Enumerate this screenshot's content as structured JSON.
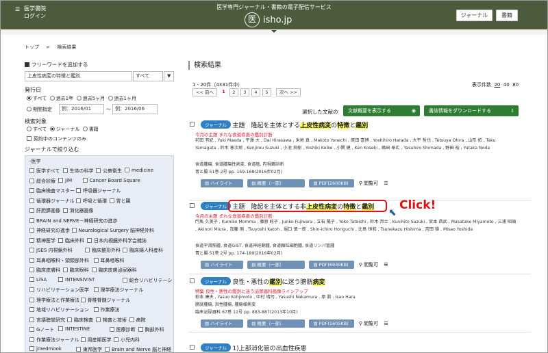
{
  "header": {
    "brand": "医学書院",
    "login": "ログイン",
    "service_title": "医学専門ジャーナル・書籍の電子配信サービス",
    "logo_text": "isho.jp",
    "journal_btn": "ジャーナル",
    "books_btn": "書籍"
  },
  "breadcrumb": {
    "top": "トップ",
    "sep": ">",
    "current": "検索結果"
  },
  "sidebar": {
    "free_word": "フリーワードを追加する",
    "search_value": "上皮性病変の特徴と鑑別",
    "search_scope": "すべて",
    "pub_date_label": "発行日",
    "pub_options": [
      "すべて",
      "過去1年",
      "過去5ヶ月",
      "過去1ヶ月"
    ],
    "period_label": "期間指定",
    "date_from": "例：2016/01",
    "date_tilde": "～",
    "date_to": "例：2016/06",
    "target_label": "検索対象",
    "target_options": [
      "すべて",
      "ジャーナル",
      "書籍"
    ],
    "contract_only": "契約中のコンテンツのみ",
    "narrow_label": "ジャーナルで絞り込む",
    "group": "-医学",
    "journals": [
      [
        "医学すべて",
        "生体の科学",
        "公衆衛生",
        "medicine"
      ],
      [
        "総合診療",
        "JIM",
        "Cancer Board Square"
      ],
      [
        "臨床検査マスター",
        "呼吸器ジャーナル"
      ],
      [
        "循環器ジャーナル",
        "呼吸と循環",
        "胃と腸"
      ],
      [
        "肝胆膵画像",
        "消化器画像"
      ],
      [
        "BRAIN and NERVE－神経研究の進歩"
      ],
      [
        "神経研究の進歩",
        "Neurological Surgery 脳神経外科"
      ],
      [
        "精神医学",
        "臨床外科",
        "日本内視鏡外科学会雑誌"
      ],
      [
        "JSES 内視鏡外科",
        "臨床整形外科",
        "臨床婦人科産科"
      ],
      [
        "耳鼻咽喉科・頭頸部外科",
        "耳鼻咽喉科"
      ],
      [
        "臨床皮膚科",
        "臨床眼科",
        "臨床皮膚泌尿器科"
      ],
      [
        "LiSA",
        "INTENSIVIST",
        "総合リハビリテーション"
      ],
      [
        "リハビリテーション医学",
        "理学療法ジャーナル"
      ],
      [
        "理学療法と作業療法",
        "脊椎脊髄ジャーナル"
      ],
      [
        "地域リハビリテーション",
        "作業療法"
      ],
      [
        "言語聴覚研究",
        "臨床検査",
        "検査と技術",
        "病院"
      ],
      [
        "Gノート",
        "INTESTINE",
        "医療診断",
        "胸部外科"
      ],
      [
        "作業療法ジャーナル",
        "周産期医学",
        "小児内科"
      ],
      [
        "jmedmook",
        "東邦医学",
        "Brain and Nerve 脳と神経"
      ]
    ]
  },
  "main": {
    "heading": "検索結果",
    "count": "1 - 20件（4331件中）",
    "per_page_label": "表示件数",
    "per_page": [
      "20",
      "40",
      "80"
    ],
    "pager": {
      "prev": "<< 前へ",
      "pages": [
        "1",
        "2",
        "3",
        "4",
        "5"
      ],
      "next": "次へ >>"
    },
    "selected_label": "選択した文献の",
    "show_abstract": "文献概要を表示する",
    "download": "書誌情報をダウンロードする",
    "actions": {
      "highlight": "ハイライト",
      "abstract": "概要（一部）",
      "read": "閲覧可"
    },
    "click_label": "Click!",
    "results": [
      {
        "tag": "ジャーナル",
        "title_a": "主題　隆起を主体とする",
        "title_h1": "上皮性病変",
        "title_b": "の",
        "title_h2": "特徴",
        "title_c": "と",
        "title_h3": "鑑別",
        "subtitle": "今月の主題 まれな食道疾患の鑑別診断",
        "authors": "前田 有紀 , Yuki Maeda , 平澤 大 , Dai Hirasawa , 米地 真 , Makoto Yonechi , 原田 喜博 , Yoshihiro Harada , 大平 哲也 , Tetsuya Ohira , 山形 拓 , Taku Yamagata , 鈴木 憲次郎 , Kenjirou Suzuki , 小池 良樹 , Yoshiki Koike , 小関 健 , Ken Koseki , 嶋田 奉広 , Yasuhiro Shimada , 野田 裕 , Yutaka Noda",
        "org": "食道腫瘍, 食道腫瘍性病変, 食道癌, 内視鏡診断",
        "cite": "胃と腸 51巻 2号 pp. 159-168(2016年02月)",
        "pdf": "PDF(2600KB)"
      },
      {
        "tag": "ジャーナル",
        "title_a": "主題　隆起を主体とする非",
        "title_h1": "上皮性病変",
        "title_b": "の",
        "title_h2": "特徴",
        "title_c": "と",
        "title_h3": "鑑別",
        "subtitle": "今月の主題 まれな食道疾患の鑑別診断",
        "authors": "門馬 久美子 , Kumiko Momma , 藤原 純子 , Junko Fujiwara , 立石 陽子 , Yoko Tateishi , 鈴木 邦士 , Kunihito Suzuki , 宮本 昌武 , Masatake Miyamoto , 三浦 昭順 , Akinori Miura , 加藤 剛 , Tsuyoshi Katoh , 堀口 慎一郎 , Shin-ichiro Horiguchi , 比島 恒和 , Tsunekazu Hishima , 吉田 操 , Misao Yoshida",
        "org": "食道平滑筋腫, 食道GIST, 食道神経鞘腫, 食道顆粒細胞腫, 食道リンパ管腫",
        "cite": "胃と腸 51巻 2号 pp. 174-189(2016年02月)",
        "pdf": "PDF(6930KB)"
      },
      {
        "tag": "ジャーナル",
        "title_a": "良性・悪性の",
        "title_h1": "鑑別",
        "title_b": "に迷う膀胱",
        "title_h2": "病変",
        "title_c": "",
        "title_h3": "",
        "subtitle": "特集 良性・悪性の鑑別に迷う泌尿器科画像ラインアップ",
        "authors": "柏本 康夫 , Yasuo Kohjimoto , 中村 靖司 , Yasushi Nakamura , 原 勲 , Isao Hara",
        "org": "膀胱腫瘍, 良性腫瘍, 腫瘍様病変",
        "cite": "臨床泌尿器科 67巻 11号 pp. 883-887(2013年10月)",
        "pdf": "PDF(1605KB)"
      },
      {
        "tag": "ジャーナル",
        "title_a": "1)上部消化管の出血性疾患"
      }
    ]
  }
}
